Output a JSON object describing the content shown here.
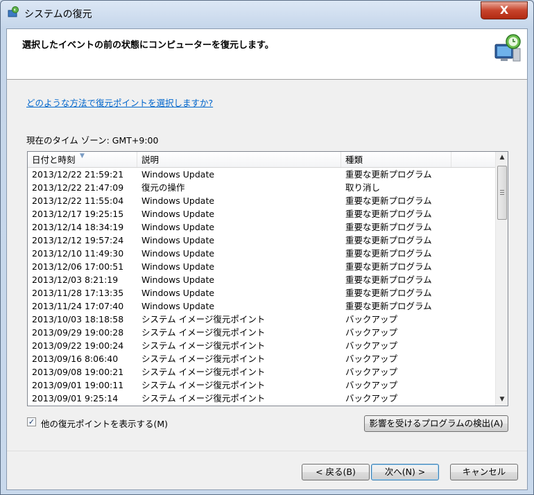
{
  "window": {
    "title": "システムの復元",
    "close_label": "X"
  },
  "header": {
    "title": "選択したイベントの前の状態にコンピューターを復元します。"
  },
  "help_link": "どのような方法で復元ポイントを選択しますか?",
  "timezone": "現在のタイム ゾーン: GMT+9:00",
  "list": {
    "columns": [
      "日付と時刻",
      "説明",
      "種類"
    ],
    "rows": [
      [
        "2013/12/22 21:59:21",
        "Windows Update",
        "重要な更新プログラム"
      ],
      [
        "2013/12/22 21:47:09",
        "復元の操作",
        "取り消し"
      ],
      [
        "2013/12/22 11:55:04",
        "Windows Update",
        "重要な更新プログラム"
      ],
      [
        "2013/12/17 19:25:15",
        "Windows Update",
        "重要な更新プログラム"
      ],
      [
        "2013/12/14 18:34:19",
        "Windows Update",
        "重要な更新プログラム"
      ],
      [
        "2013/12/12 19:57:24",
        "Windows Update",
        "重要な更新プログラム"
      ],
      [
        "2013/12/10 11:49:30",
        "Windows Update",
        "重要な更新プログラム"
      ],
      [
        "2013/12/06 17:00:51",
        "Windows Update",
        "重要な更新プログラム"
      ],
      [
        "2013/12/03 8:21:19",
        "Windows Update",
        "重要な更新プログラム"
      ],
      [
        "2013/11/28 17:13:35",
        "Windows Update",
        "重要な更新プログラム"
      ],
      [
        "2013/11/24 17:07:40",
        "Windows Update",
        "重要な更新プログラム"
      ],
      [
        "2013/10/03 18:18:58",
        "システム イメージ復元ポイント",
        "バックアップ"
      ],
      [
        "2013/09/29 19:00:28",
        "システム イメージ復元ポイント",
        "バックアップ"
      ],
      [
        "2013/09/22 19:00:24",
        "システム イメージ復元ポイント",
        "バックアップ"
      ],
      [
        "2013/09/16 8:06:40",
        "システム イメージ復元ポイント",
        "バックアップ"
      ],
      [
        "2013/09/08 19:00:21",
        "システム イメージ復元ポイント",
        "バックアップ"
      ],
      [
        "2013/09/01 19:00:11",
        "システム イメージ復元ポイント",
        "バックアップ"
      ],
      [
        "2013/09/01 9:25:14",
        "システム イメージ復元ポイント",
        "バックアップ"
      ]
    ]
  },
  "show_more_checkbox": {
    "label": "他の復元ポイントを表示する(M)",
    "checked": true
  },
  "buttons": {
    "scan": "影響を受けるプログラムの検出(A)",
    "back": "< 戻る(B)",
    "next": "次へ(N) >",
    "cancel": "キャンセル"
  },
  "icons": {
    "title": "system-restore-icon",
    "header": "computer-restore-icon"
  }
}
